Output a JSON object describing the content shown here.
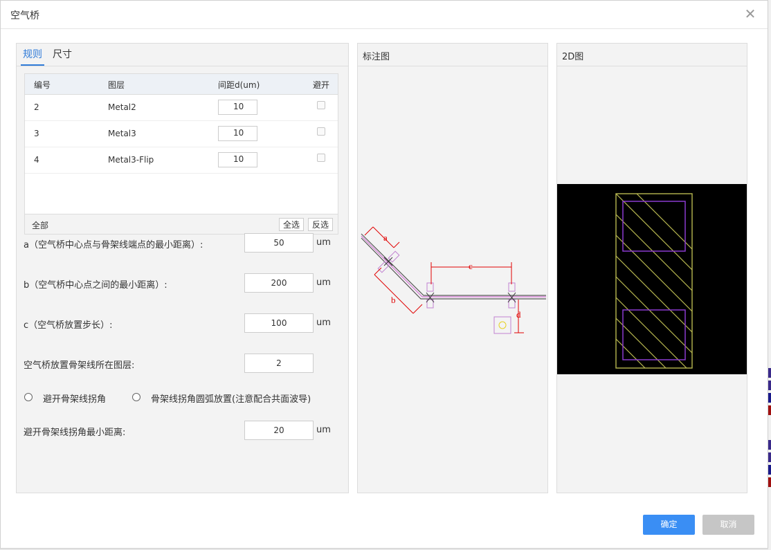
{
  "dialog": {
    "title": "空气桥"
  },
  "tabs": [
    "规则",
    "尺寸"
  ],
  "panels": {
    "annotation_title": "标注图",
    "view2d_title": "2D图"
  },
  "table": {
    "headers": [
      "编号",
      "图层",
      "间距d(um)",
      "避开"
    ],
    "rows": [
      {
        "id": "2",
        "layer": "Metal2",
        "spacing": "10"
      },
      {
        "id": "3",
        "layer": "Metal3",
        "spacing": "10"
      },
      {
        "id": "4",
        "layer": "Metal3-Flip",
        "spacing": "10"
      }
    ],
    "footer_label": "全部",
    "select_all": "全选",
    "invert_select": "反选"
  },
  "form": {
    "a_label": "a（空气桥中心点与骨架线端点的最小距离）:",
    "a_value": "50",
    "b_label": "b（空气桥中心点之间的最小距离）:",
    "b_value": "200",
    "c_label": "c（空气桥放置步长）:",
    "c_value": "100",
    "layer_label": "空气桥放置骨架线所在图层:",
    "layer_value": "2",
    "radio1": "避开骨架线拐角",
    "radio2": "骨架线拐角圆弧放置(注意配合共面波导)",
    "corner_label": "避开骨架线拐角最小距离:",
    "corner_value": "20",
    "unit": "um"
  },
  "diagram_labels": {
    "a": "a",
    "b": "b",
    "c": "c",
    "d": "d"
  },
  "buttons": {
    "ok": "确定",
    "cancel": "取消"
  },
  "colors": {
    "accent": "#2f7bd8",
    "ok_button": "#3a8ef4",
    "cancel_button": "#c6c6c6",
    "dimension_red": "#e00000"
  }
}
